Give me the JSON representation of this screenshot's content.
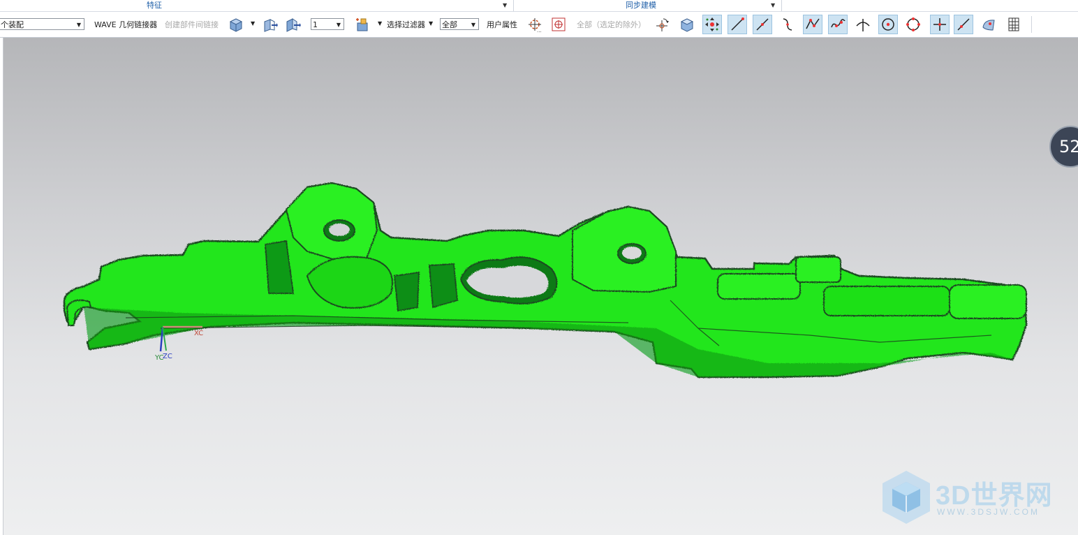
{
  "ribbon": {
    "groups": [
      {
        "label": "特征"
      },
      {
        "label": "同步建模"
      }
    ]
  },
  "toolbar": {
    "assembly_select": "个装配",
    "wave_label": "WAVE 几何链接器",
    "create_link_label": "创建部件间链接",
    "count_select": "1",
    "filter_label": "选择过滤器",
    "scope_select": "全部",
    "user_attr_label": "用户属性",
    "all_except_label": "全部（选定的除外）"
  },
  "icons": [
    "solid-body-icon",
    "face-extract-icon",
    "body-link-icon",
    "add-component-icon",
    "move-snap-icon",
    "point-target-icon",
    "rotate-icon",
    "box-view-icon",
    "snap-point-icon",
    "line-end-icon",
    "line-mid-icon",
    "curve-icon",
    "polyline-icon",
    "spline-icon",
    "intersect-icon",
    "arc-center-icon",
    "circle-quad-icon",
    "cross-point-icon",
    "bisect-icon",
    "face-icon",
    "grid-icon"
  ],
  "viewport": {
    "axis_labels": {
      "x": "XC",
      "y": "YC",
      "z": "ZC"
    },
    "gauge_value": "52",
    "model_color": "#22e61a"
  },
  "watermark": {
    "text": "3D世界网",
    "url": "WWW.3DSJW.COM"
  }
}
